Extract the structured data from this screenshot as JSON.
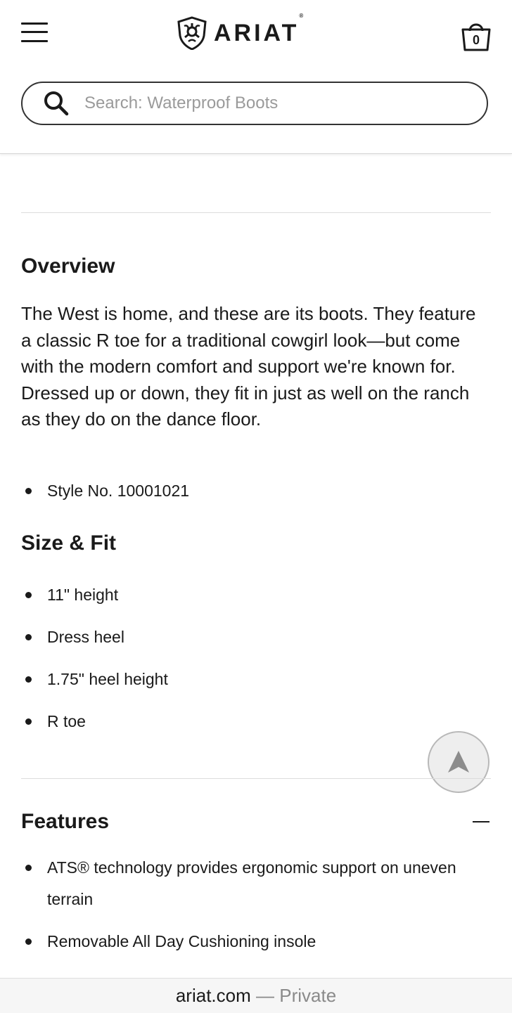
{
  "header": {
    "brand": "ARIAT",
    "brand_mark": "®",
    "cart_count": "0",
    "search_placeholder": "Search: Waterproof Boots"
  },
  "overview": {
    "heading": "Overview",
    "description": "The West is home, and these are its boots. They feature a classic R toe for a traditional cowgirl look—but come with the modern comfort and support we're known for. Dressed up or down, they fit in just as well on the ranch as they do on the dance floor.",
    "style_no": "Style No. 10001021"
  },
  "size_fit": {
    "heading": "Size & Fit",
    "items": [
      "11\" height",
      "Dress heel",
      "1.75\" heel height",
      "R toe"
    ]
  },
  "features": {
    "heading": "Features",
    "toggle_symbol": "—",
    "items": [
      "ATS® technology provides ergonomic support on uneven terrain",
      "Removable All Day Cushioning insole"
    ]
  },
  "browser": {
    "domain": "ariat.com",
    "separator": "—",
    "mode": "Private"
  }
}
